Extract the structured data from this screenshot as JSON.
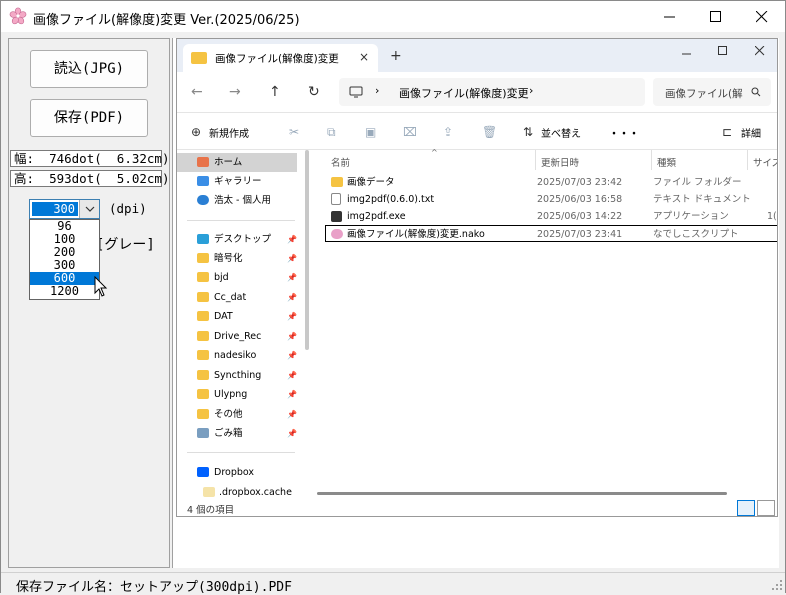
{
  "window": {
    "title": "画像ファイル(解像度)変更 Ver.(2025/06/25)",
    "icon": "sakura-icon"
  },
  "left": {
    "read_button": "読込(JPG)",
    "save_button": "保存(PDF)",
    "width_label": "幅:  746dot(  6.32cm)",
    "height_label": "高:  593dot(  5.02cm)",
    "dpi_selected": "300",
    "dpi_unit": "(dpi)",
    "gray_label": "[グレー]",
    "dpi_options": [
      "96",
      "100",
      "200",
      "300",
      "600",
      "1200"
    ],
    "dpi_highlighted": "600"
  },
  "status": {
    "text": "保存ファイル名：セットアップ(300dpi).PDF"
  },
  "explorer": {
    "tab_label": "画像ファイル(解像度)変更",
    "tab_close": "×",
    "new_tab": "+",
    "address": "画像ファイル(解像度)変更",
    "search_placeholder": "画像ファイル(解",
    "toolbar": {
      "new": "新規作成",
      "sort": "並べ替え",
      "more": "・・・",
      "details": "詳細"
    },
    "nav_items": [
      {
        "label": "ホーム",
        "color": "#e8734a"
      },
      {
        "label": "ギャラリー",
        "color": "#3a8ee6"
      },
      {
        "label": "浩太 - 個人用",
        "color": "#2a7fd4"
      },
      {
        "label": "デスクトップ",
        "color": "#2a9fd8"
      },
      {
        "label": "暗号化",
        "color": "#f5c342"
      },
      {
        "label": "bjd",
        "color": "#f5c342"
      },
      {
        "label": "Cc_dat",
        "color": "#f5c342"
      },
      {
        "label": "DAT",
        "color": "#f5c342"
      },
      {
        "label": "Drive_Rec",
        "color": "#f5c342"
      },
      {
        "label": "nadesiko",
        "color": "#f5c342"
      },
      {
        "label": "Syncthing",
        "color": "#f5c342"
      },
      {
        "label": "Ulypng",
        "color": "#f5c342"
      },
      {
        "label": "その他",
        "color": "#f5c342"
      },
      {
        "label": "ごみ箱",
        "color": "#7a9ec0"
      },
      {
        "label": "Dropbox",
        "color": "#0061fe"
      },
      {
        "label": ".dropbox.cache",
        "color": "#f5e3a8"
      }
    ],
    "columns": [
      "名前",
      "更新日時",
      "種類",
      "サイズ"
    ],
    "files": [
      {
        "name": "画像データ",
        "date": "2025/07/03 23:42",
        "type": "ファイル フォルダー",
        "size": "",
        "color": "#f5c342"
      },
      {
        "name": "img2pdf(0.6.0).txt",
        "date": "2025/06/03 16:58",
        "type": "テキスト ドキュメント",
        "size": "",
        "color": "#dddddd"
      },
      {
        "name": "img2pdf.exe",
        "date": "2025/06/03 14:22",
        "type": "アプリケーション",
        "size": "1(",
        "color": "#333333"
      },
      {
        "name": "画像ファイル(解像度)変更.nako",
        "date": "2025/07/03 23:41",
        "type": "なでしこスクリプト",
        "size": "",
        "color": "#e9a0c8"
      }
    ],
    "status": "4 個の項目"
  }
}
